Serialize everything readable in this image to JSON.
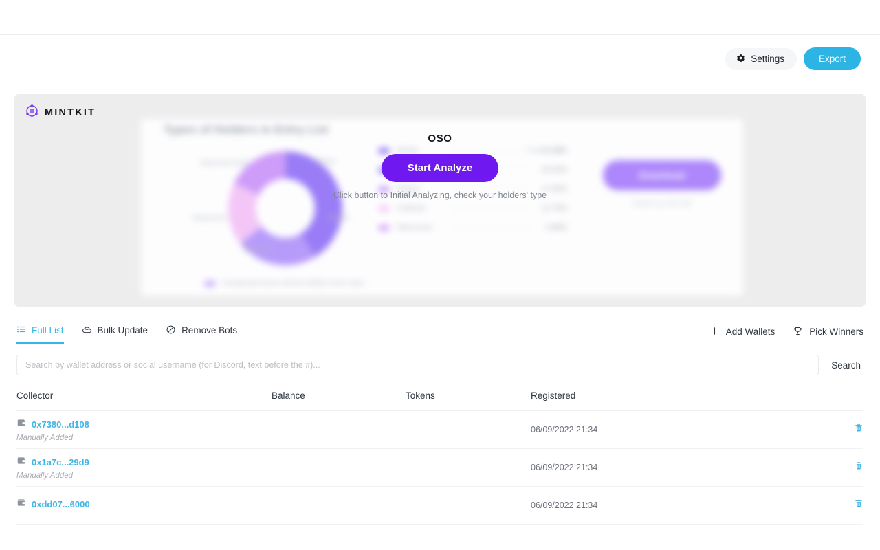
{
  "header": {
    "settings_label": "Settings",
    "export_label": "Export",
    "settings_icon": "gear-icon",
    "accent_blue": "#2cb5e4"
  },
  "panel": {
    "brand_name": "MINTKIT",
    "brand_icon": "mintkit-logo-icon",
    "overlay": {
      "badge": "OSO",
      "analyze_label": "Start Analyze",
      "hint": "Click button to Initial Analyzing, check your holders' type",
      "analyze_color": "#6f18ef"
    },
    "chart_card": {
      "title": "Types of Holders in Entry List",
      "legend_header": "Total Count",
      "download_label": "Download",
      "download_note": "Export as CSV file",
      "footer_label": "Unselected items will be hidden from chart"
    }
  },
  "chart_data": {
    "type": "pie",
    "title": "Types of Holders in Entry List",
    "categories": [
      "Whale",
      "Diamond Hand",
      "Flipper",
      "Collector",
      "Newcomer"
    ],
    "values": [
      41.2,
      23.5,
      17.6,
      11.8,
      5.9
    ],
    "value_labels": [
      "41.18%",
      "23.53%",
      "17.65%",
      "11.76%",
      "5.88%"
    ],
    "colors": [
      "#9a7cf7",
      "#8f86fb",
      "#c79bfb",
      "#f6c9f6",
      "#d9a6f8"
    ],
    "legend_position": "right",
    "donut": true,
    "grid": false
  },
  "tabs": {
    "items": [
      {
        "label": "Full List",
        "icon": "list-icon",
        "active": true
      },
      {
        "label": "Bulk Update",
        "icon": "cloud-upload-icon",
        "active": false
      },
      {
        "label": "Remove Bots",
        "icon": "ban-icon",
        "active": false
      }
    ],
    "right_actions": [
      {
        "label": "Add Wallets",
        "icon": "plus-icon"
      },
      {
        "label": "Pick Winners",
        "icon": "trophy-icon"
      }
    ],
    "active_color": "#34b7e8"
  },
  "search": {
    "value": "",
    "placeholder": "Search by wallet address or social username (for Discord, text before the #)...",
    "button_label": "Search"
  },
  "table": {
    "columns": [
      "Collector",
      "Balance",
      "Tokens",
      "Registered"
    ],
    "rows": [
      {
        "collector": "0x7380...d108",
        "note": "Manually Added",
        "balance": "",
        "tokens": "",
        "registered": "06/09/2022 21:34",
        "wallet_icon": "wallet-icon",
        "delete_icon": "trash-icon"
      },
      {
        "collector": "0x1a7c...29d9",
        "note": "Manually Added",
        "balance": "",
        "tokens": "",
        "registered": "06/09/2022 21:34",
        "wallet_icon": "wallet-icon",
        "delete_icon": "trash-icon"
      },
      {
        "collector": "0xdd07...6000",
        "note": "",
        "balance": "",
        "tokens": "",
        "registered": "06/09/2022 21:34",
        "wallet_icon": "wallet-icon",
        "delete_icon": "trash-icon"
      }
    ]
  }
}
